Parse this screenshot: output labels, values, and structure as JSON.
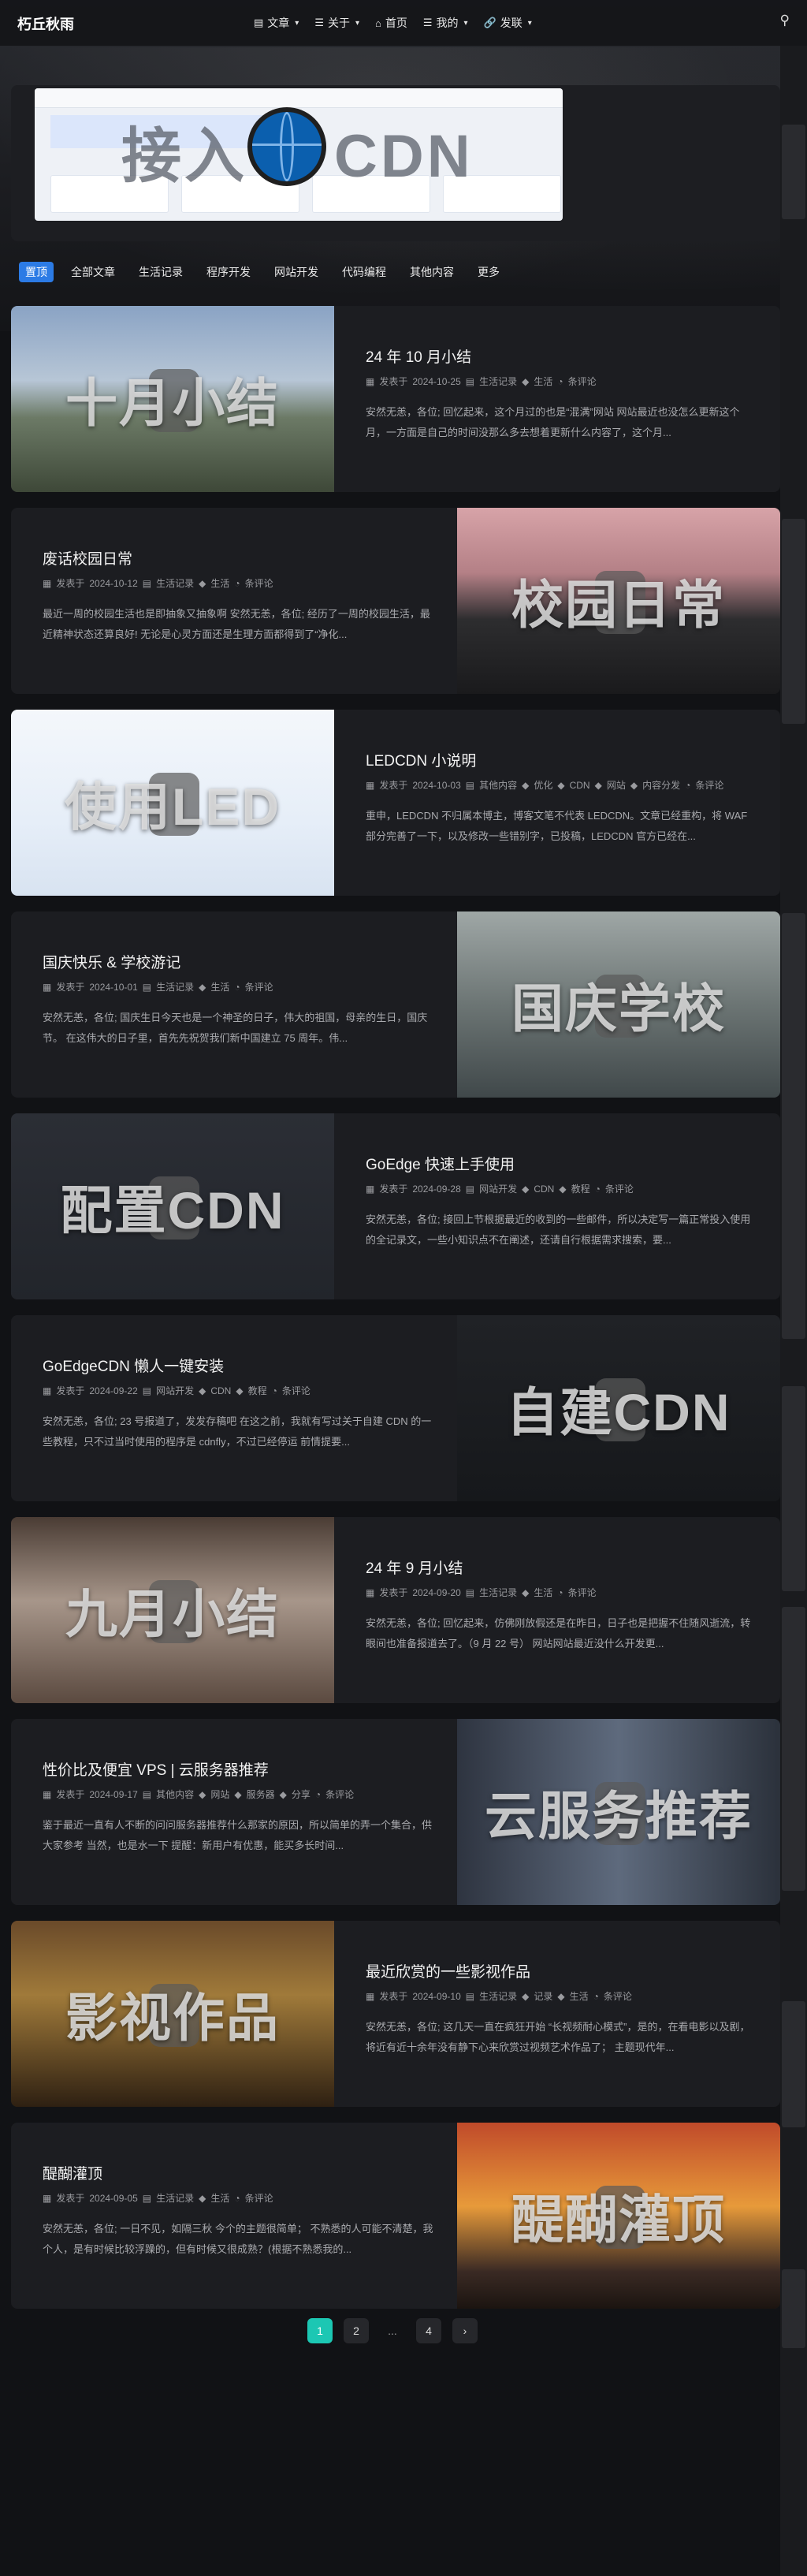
{
  "site": {
    "title": "朽丘秋雨"
  },
  "nav": {
    "items": [
      {
        "icon": "folder-icon",
        "glyph": "▤",
        "label": "文章",
        "dropdown": true
      },
      {
        "icon": "list-icon",
        "glyph": "☰",
        "label": "关于",
        "dropdown": true
      },
      {
        "icon": "home-icon",
        "glyph": "⌂",
        "label": "首页",
        "dropdown": false
      },
      {
        "icon": "list-icon",
        "glyph": "☰",
        "label": "我的",
        "dropdown": true
      },
      {
        "icon": "link-icon",
        "glyph": "🔗",
        "label": "发联",
        "dropdown": true
      }
    ]
  },
  "banner": {
    "text_left": "接入",
    "text_right": "CDN"
  },
  "tabs": [
    "置顶",
    "全部文章",
    "生活记录",
    "程序开发",
    "网站开发",
    "代码编程",
    "其他内容",
    "更多"
  ],
  "meta_prefix": "发表于",
  "comment_suffix": "条评论",
  "posts": [
    {
      "title": "24 年 10 月小结",
      "thumb_text": "十月小结",
      "date": "2024-10-25",
      "category": "生活记录",
      "tags": [
        "生活"
      ],
      "excerpt": "安然无恙，各位;  回忆起来，这个月过的也是“混满”网站 网站最近也没怎么更新这个月，一方面是自己的时间没那么多去想着更新什么内容了，这个月..."
    },
    {
      "title": "废话校园日常",
      "thumb_text": "校园日常",
      "date": "2024-10-12",
      "category": "生活记录",
      "tags": [
        "生活"
      ],
      "excerpt": "最近一周的校园生活也是即抽象又抽象啊 安然无恙，各位;  经历了一周的校园生活，最近精神状态还算良好!  无论是心灵方面还是生理方面都得到了“净化..."
    },
    {
      "title": "LEDCDN 小说明",
      "thumb_text": "使用LED",
      "date": "2024-10-03",
      "category": "其他内容",
      "tags": [
        "优化",
        "CDN",
        "网站",
        "内容分发"
      ],
      "excerpt": "重申，LEDCDN 不归属本博主，博客文笔不代表 LEDCDN。文章已经重构，将 WAF 部分完善了一下，以及修改一些错别字，已投稿，LEDCDN 官方已经在..."
    },
    {
      "title": "国庆快乐 & 学校游记",
      "thumb_text": "国庆学校",
      "date": "2024-10-01",
      "category": "生活记录",
      "tags": [
        "生活"
      ],
      "excerpt": "安然无恙，各位;  国庆生日今天也是一个神圣的日子，伟大的祖国，母亲的生日，国庆节。 在这伟大的日子里，首先先祝贺我们新中国建立 75 周年。伟..."
    },
    {
      "title": "GoEdge 快速上手使用",
      "thumb_text": "配置CDN",
      "date": "2024-09-28",
      "category": "网站开发",
      "tags": [
        "CDN",
        "教程"
      ],
      "excerpt": "安然无恙，各位;  接回上节根据最近的收到的一些邮件，所以决定写一篇正常投入使用的全记录文，一些小知识点不在阐述，还请自行根据需求搜索，要..."
    },
    {
      "title": "GoEdgeCDN 懒人一键安装",
      "thumb_text": "自建CDN",
      "date": "2024-09-22",
      "category": "网站开发",
      "tags": [
        "CDN",
        "教程"
      ],
      "excerpt": "安然无恙，各位;  23 号报道了，发发存稿吧 在这之前，我就有写过关于自建 CDN 的一些教程，只不过当时使用的程序是 cdnfly，不过已经停运 前情提要..."
    },
    {
      "title": "24 年 9 月小结",
      "thumb_text": "九月小结",
      "date": "2024-09-20",
      "category": "生活记录",
      "tags": [
        "生活"
      ],
      "excerpt": "安然无恙，各位;  回忆起来，仿佛刚放假还是在昨日，日子也是把握不住随风逝流，转眼间也准备报道去了。（9 月 22 号） 网站网站最近没什么开发更..."
    },
    {
      "title": "性价比及便宜 VPS | 云服务器推荐",
      "thumb_text": "云服务推荐",
      "date": "2024-09-17",
      "category": "其他内容",
      "tags": [
        "网站",
        "服务器",
        "分享"
      ],
      "excerpt": "鉴于最近一直有人不断的问问服务器推荐什么那家的原因，所以简单的弄一个集合，供大家参考 当然，也是水一下 提醒：新用户有优惠，能买多长时间..."
    },
    {
      "title": "最近欣赏的一些影视作品",
      "thumb_text": "影视作品",
      "date": "2024-09-10",
      "category": "生活记录",
      "tags": [
        "记录",
        "生活"
      ],
      "excerpt": "安然无恙，各位;  这几天一直在疯狂开始 “长视频耐心模式”，是的，在看电影以及剧，将近有近十余年没有静下心来欣赏过视频艺术作品了；  主题现代年..."
    },
    {
      "title": "醍醐灌顶",
      "thumb_text": "醍醐灌顶",
      "date": "2024-09-05",
      "category": "生活记录",
      "tags": [
        "生活"
      ],
      "excerpt": "安然无恙，各位;  一日不见，如隔三秋 今个的主题很简单；  不熟悉的人可能不清楚，我个人，是有时候比较浮躁的，但有时候又很成熟？(根据不熟悉我的..."
    }
  ],
  "pagination": {
    "pages": [
      "1",
      "2",
      "...",
      "4"
    ],
    "next": "›",
    "current": "1"
  }
}
